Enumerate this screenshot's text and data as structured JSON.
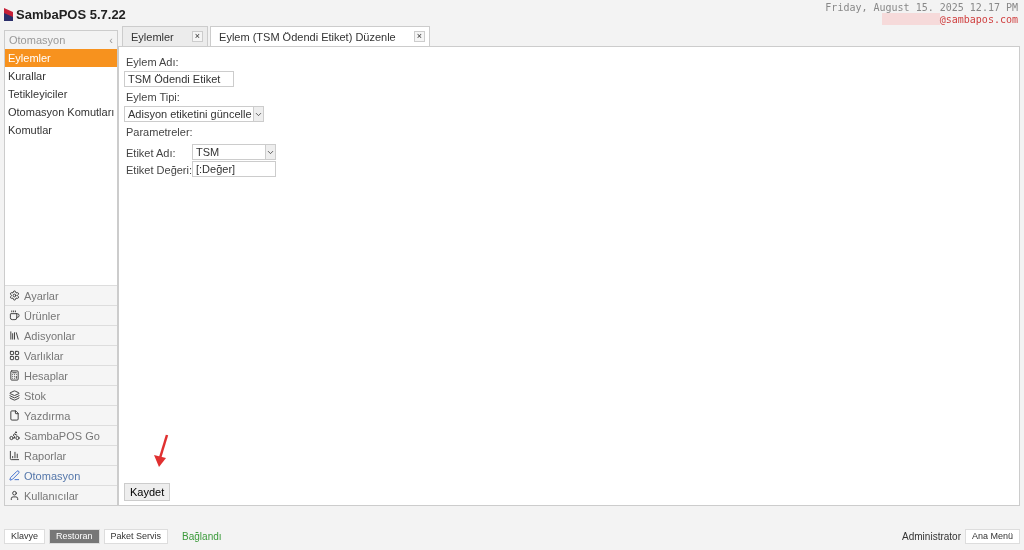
{
  "app": {
    "title": "SambaPOS 5.7.22"
  },
  "header": {
    "datetime": "Friday, August 15. 2025 12.17 PM",
    "user_email": "@sambapos.com"
  },
  "sidebar": {
    "section_title": "Otomasyon",
    "collapse_glyph": "‹",
    "items": [
      {
        "label": "Eylemler",
        "selected": true
      },
      {
        "label": "Kurallar",
        "selected": false
      },
      {
        "label": "Tetikleyiciler",
        "selected": false
      },
      {
        "label": "Otomasyon Komutları",
        "selected": false
      },
      {
        "label": "Komutlar",
        "selected": false
      }
    ],
    "modules": [
      {
        "label": "Ayarlar",
        "selected": false
      },
      {
        "label": "Ürünler",
        "selected": false
      },
      {
        "label": "Adisyonlar",
        "selected": false
      },
      {
        "label": "Varlıklar",
        "selected": false
      },
      {
        "label": "Hesaplar",
        "selected": false
      },
      {
        "label": "Stok",
        "selected": false
      },
      {
        "label": "Yazdırma",
        "selected": false
      },
      {
        "label": "SambaPOS Go",
        "selected": false
      },
      {
        "label": "Raporlar",
        "selected": false
      },
      {
        "label": "Otomasyon",
        "selected": true
      },
      {
        "label": "Kullanıcılar",
        "selected": false
      }
    ]
  },
  "tabs": [
    {
      "label": "Eylemler",
      "close": "×",
      "selected": false
    },
    {
      "label": "Eylem (TSM Ödendi Etiket) Düzenle",
      "close": "×",
      "selected": true
    }
  ],
  "form": {
    "name_label": "Eylem Adı:",
    "name_value": "TSM Ödendi Etiket",
    "type_label": "Eylem Tipi:",
    "type_value": "Adisyon etiketini güncelle",
    "parameters_label": "Parametreler:",
    "parameters": [
      {
        "label": "Etiket Adı:",
        "value": "TSM",
        "kind": "select"
      },
      {
        "label": "Etiket Değeri:",
        "value": "[:Değer]",
        "kind": "text"
      }
    ],
    "save_button": "Kaydet"
  },
  "status_bar": {
    "buttons": [
      {
        "label": "Klavye",
        "selected": false
      },
      {
        "label": "Restoran",
        "selected": true
      },
      {
        "label": "Paket Servis",
        "selected": false
      }
    ],
    "connection": "Bağlandı",
    "user": "Administrator",
    "menu_button": "Ana Menü"
  }
}
